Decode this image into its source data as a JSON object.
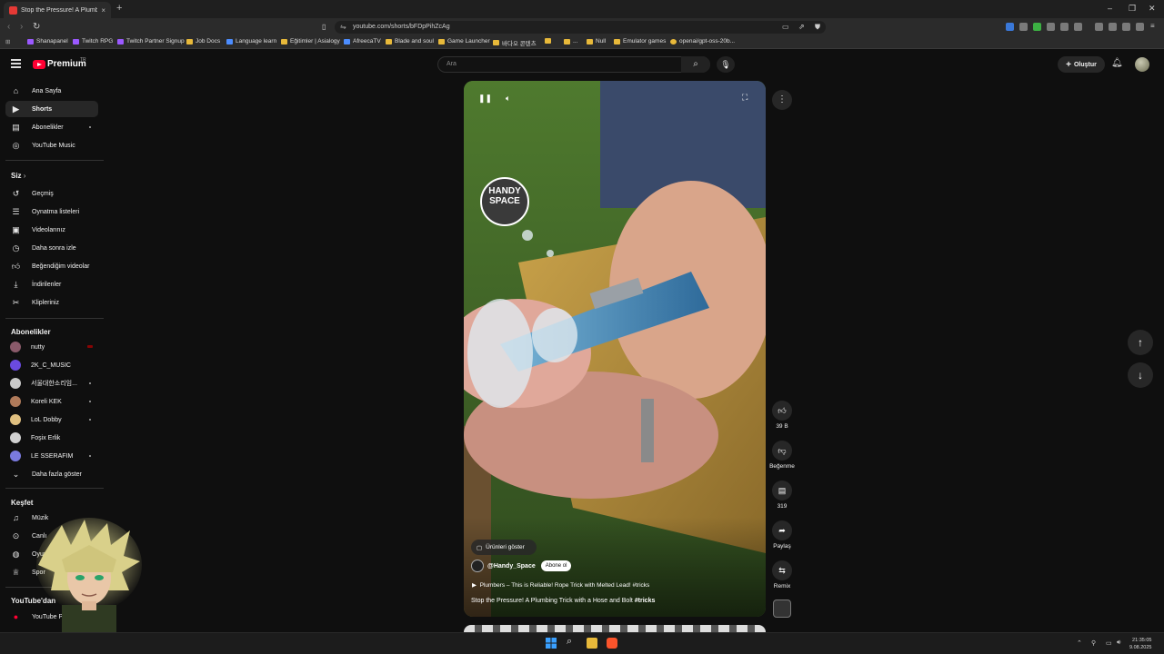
{
  "browser": {
    "tab_title": "Stop the Pressure! A Plumbin",
    "tab_close": "×",
    "new_tab": "+",
    "url": "youtube.com/shorts/bFDpPihZcAg",
    "bookmarks": [
      "Shanapanel",
      "Twitch RPG",
      "Twitch Partner Signup",
      "Job Docs",
      "Language learn",
      "Eğitimler | Asialogy",
      "AfreecaTV",
      "Blade and soul",
      "Game Launcher",
      "바다오 콘텐츠",
      "",
      "...",
      "Null",
      "Emulator games",
      "openai/gpt-oss-20b..."
    ]
  },
  "youtube": {
    "brand": "Premium",
    "brand_sup": "TR",
    "search_placeholder": "Ara",
    "create_label": "Oluştur"
  },
  "sidebar": {
    "main": [
      {
        "label": "Ana Sayfa",
        "icon": "home-icon"
      },
      {
        "label": "Shorts",
        "icon": "shorts-icon"
      },
      {
        "label": "Abonelikler",
        "icon": "subscriptions-icon"
      },
      {
        "label": "YouTube Music",
        "icon": "music-circle-icon"
      }
    ],
    "you_title": "Siz",
    "you": [
      {
        "label": "Geçmiş",
        "icon": "history-icon"
      },
      {
        "label": "Oynatma listeleri",
        "icon": "playlist-icon"
      },
      {
        "label": "Videolarınız",
        "icon": "your-videos-icon"
      },
      {
        "label": "Daha sonra izle",
        "icon": "clock-icon"
      },
      {
        "label": "Beğendiğim videolar",
        "icon": "thumb-up-icon"
      },
      {
        "label": "İndirilenler",
        "icon": "download-icon"
      },
      {
        "label": "Klipleriniz",
        "icon": "scissors-icon"
      }
    ],
    "subs_title": "Abonelikler",
    "subs": [
      {
        "label": "nutty",
        "color": "#8a5a6a"
      },
      {
        "label": "2K_C_MUSIC",
        "color": "#6a4adf"
      },
      {
        "label": "서울대한소리임...",
        "color": "#c9c9c9"
      },
      {
        "label": "Koreli KEK",
        "color": "#b07a5a"
      },
      {
        "label": "LoL Dobby",
        "color": "#e0c080"
      },
      {
        "label": "Foşix Erlik",
        "color": "#d0d0d0"
      },
      {
        "label": "LE SSERAFIM",
        "color": "#7a7adf"
      }
    ],
    "show_more": "Daha fazla göster",
    "explore_title": "Keşfet",
    "explore": [
      {
        "label": "Müzik",
        "icon": "music-note-icon"
      },
      {
        "label": "Canlı",
        "icon": "live-icon"
      },
      {
        "label": "Oyun",
        "icon": "gamepad-icon"
      },
      {
        "label": "Spor",
        "icon": "trophy-icon"
      }
    ],
    "more_title": "YouTube'dan",
    "more": [
      {
        "label": "YouTube Premium",
        "icon": "youtube-icon"
      }
    ]
  },
  "short": {
    "channel_logo": "HANDY SPACE",
    "products_label": "Ürünleri göster",
    "handle": "@Handy_Space",
    "subscribe_label": "Abone ol",
    "related": "Plumbers – This is Reliable! Rope Trick with Melted Lead! #tricks",
    "title": "Stop the Pressure! A Plumbing Trick with a Hose and Bolt",
    "title_tag": "#tricks",
    "likes": "39 B",
    "dislike_label": "Beğenme",
    "comments": "319",
    "share_label": "Paylaş",
    "remix_label": "Remix"
  },
  "taskbar": {
    "time": "21:35:05",
    "date": "9.08.2025"
  },
  "colors": {
    "accent": "#ff0033",
    "bg": "#0f0f0f"
  }
}
